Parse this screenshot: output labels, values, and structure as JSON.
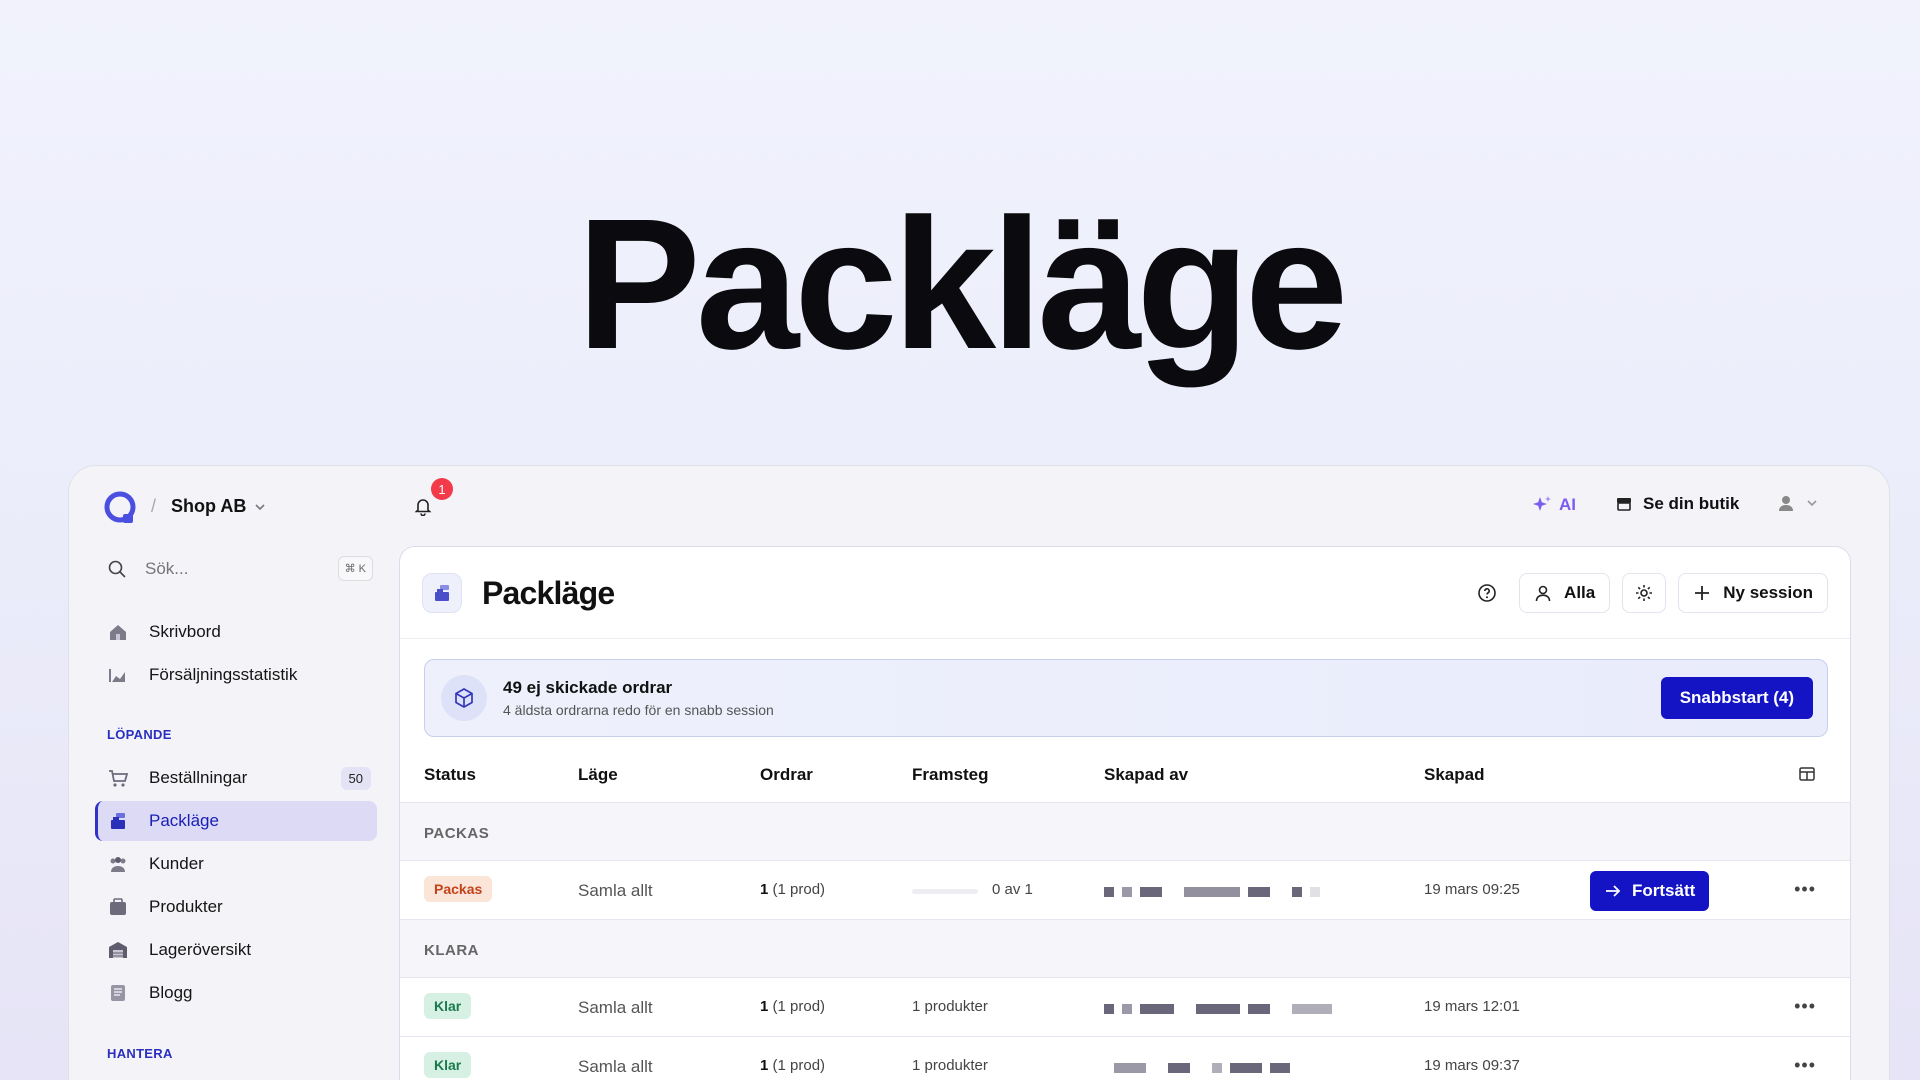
{
  "hero": {
    "title": "Packläge"
  },
  "topbar": {
    "shop_name": "Shop AB",
    "notification_count": "1",
    "ai_label": "AI",
    "store_label": "Se din butik"
  },
  "sidebar": {
    "search_placeholder": "Sök...",
    "search_shortcut": "⌘ K",
    "items_top": [
      {
        "label": "Skrivbord",
        "icon": "home-icon"
      },
      {
        "label": "Försäljningsstatistik",
        "icon": "chart-icon"
      }
    ],
    "section_running": "LÖPANDE",
    "items_running": [
      {
        "label": "Beställningar",
        "icon": "cart-icon",
        "count": "50"
      },
      {
        "label": "Packläge",
        "icon": "pack-icon",
        "active": true
      },
      {
        "label": "Kunder",
        "icon": "users-icon"
      },
      {
        "label": "Produkter",
        "icon": "box-icon"
      },
      {
        "label": "Lageröversikt",
        "icon": "warehouse-icon"
      },
      {
        "label": "Blogg",
        "icon": "blog-icon"
      }
    ],
    "section_manage": "HANTERA"
  },
  "main": {
    "title": "Packläge",
    "filter_label": "Alla",
    "new_session_label": "Ny session"
  },
  "banner": {
    "title": "49 ej skickade ordrar",
    "subtitle": "4 äldsta ordrarna redo för en snabb session",
    "action_label": "Snabbstart (4)"
  },
  "table": {
    "columns": [
      "Status",
      "Läge",
      "Ordrar",
      "Framsteg",
      "Skapad av",
      "Skapad"
    ],
    "groups": [
      {
        "label": "PACKAS",
        "rows": [
          {
            "status": "Packas",
            "mode": "Samla allt",
            "orders_count": "1",
            "orders_detail": "(1 prod)",
            "progress": "0 av 1",
            "progress_fraction": 0,
            "created": "19 mars 09:25",
            "action": "Fortsätt"
          }
        ]
      },
      {
        "label": "KLARA",
        "rows": [
          {
            "status": "Klar",
            "mode": "Samla allt",
            "orders_count": "1",
            "orders_detail": "(1 prod)",
            "progress": "1 produkter",
            "created": "19 mars 12:01"
          },
          {
            "status": "Klar",
            "mode": "Samla allt",
            "orders_count": "1",
            "orders_detail": "(1 prod)",
            "progress": "1 produkter",
            "created": "19 mars 09:37"
          }
        ]
      }
    ]
  },
  "colors": {
    "accent": "#1414c4",
    "brand": "#4b4fe0",
    "badge": "#f23a4a"
  }
}
